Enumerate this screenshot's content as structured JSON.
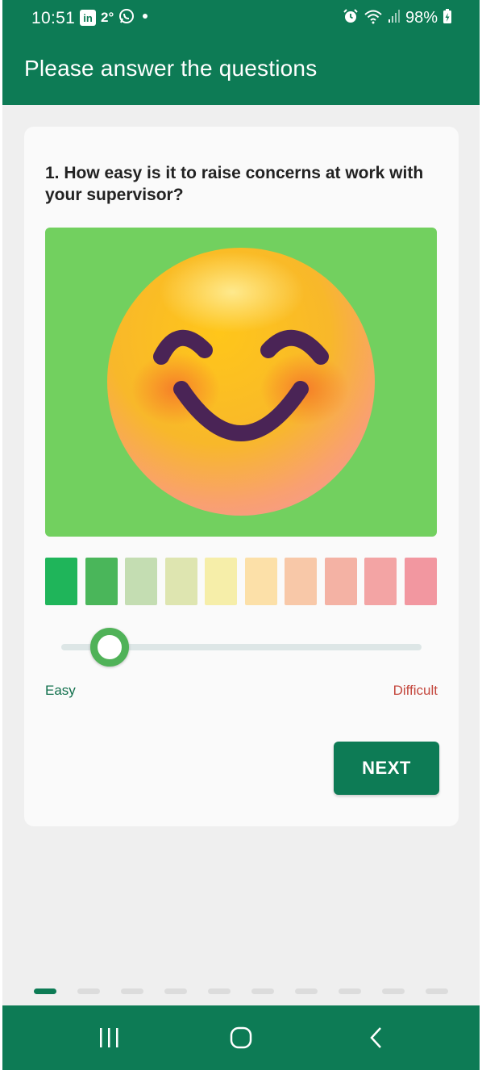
{
  "status_bar": {
    "time": "10:51",
    "linkedin_label": "in",
    "temperature": "2°",
    "battery": "98%",
    "icons": [
      "linkedin-icon",
      "whatsapp-icon",
      "notification-dot-icon",
      "alarm-icon",
      "wifi-icon",
      "signal-icon",
      "battery-charging-icon"
    ]
  },
  "app_bar": {
    "title": "Please answer the questions"
  },
  "question": {
    "text": "1. How easy is it to raise concerns at work with your supervisor?",
    "image_icon": "smiling-face-icon"
  },
  "scale": {
    "colors": [
      "#1fb55a",
      "#4ab65a",
      "#c4ddb2",
      "#dee5b0",
      "#f6eea9",
      "#fce0a8",
      "#f8c8a8",
      "#f4b2a4",
      "#f3a4a4",
      "#f297a0"
    ],
    "slider_value_fraction": 0.12,
    "slider_accent": "#50b258",
    "min_label": "Easy",
    "max_label": "Difficult"
  },
  "actions": {
    "next_label": "NEXT"
  },
  "pager": {
    "total": 10,
    "current": 1
  },
  "nav_bar": {
    "icons": [
      "recent-apps-icon",
      "home-icon",
      "back-icon"
    ]
  },
  "colors": {
    "primary": "#0d7b55",
    "background": "#efefef",
    "card": "#fafafa",
    "emoji_background": "#72d05f",
    "difficult_text": "#c4473d"
  }
}
